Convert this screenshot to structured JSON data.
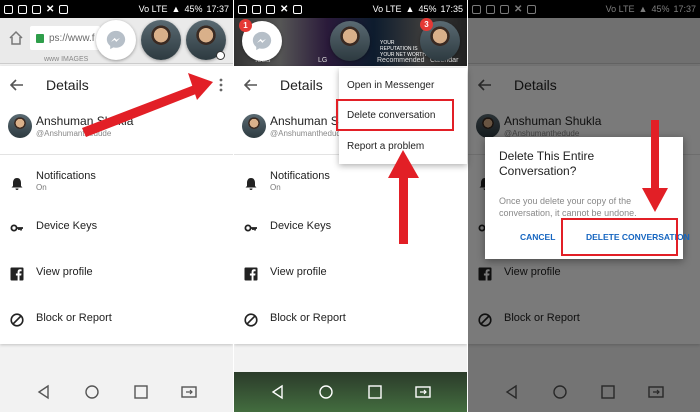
{
  "status_bar": {
    "battery": "45%",
    "time": "17:37",
    "time_panel2": "17:35",
    "network": "Vo LTE"
  },
  "browser": {
    "url_fragment": "ps://www.f",
    "tabs_strip_text": "www  IMAGES"
  },
  "chat_heads": {
    "panel2_badge_left": "1",
    "panel2_badge_right": "3"
  },
  "photo_strip_captions": {
    "tools": "Tools",
    "lg": "LG",
    "recommended": "Recommended",
    "calendar": "Calendar",
    "banner": "YOUR REPUTATION IS YOUR NET WORTH"
  },
  "details": {
    "title": "Details",
    "profile_name": "Anshuman Shukla",
    "profile_handle": "@Anshumanthedude",
    "rows": {
      "notifications_label": "Notifications",
      "notifications_sub": "On",
      "device_keys": "Device Keys",
      "view_profile": "View profile",
      "block_report": "Block or Report"
    }
  },
  "menu": {
    "open_in_messenger": "Open in Messenger",
    "delete_conversation": "Delete conversation",
    "report_problem": "Report a problem"
  },
  "dialog": {
    "title": "Delete This Entire Conversation?",
    "body": "Once you delete your copy of the conversation, it cannot be undone.",
    "cancel": "CANCEL",
    "confirm": "DELETE CONVERSATION"
  },
  "colors": {
    "annotation_red": "#e21f26",
    "messenger_blue": "#0084ff",
    "dialog_button_blue": "#1565c0"
  }
}
